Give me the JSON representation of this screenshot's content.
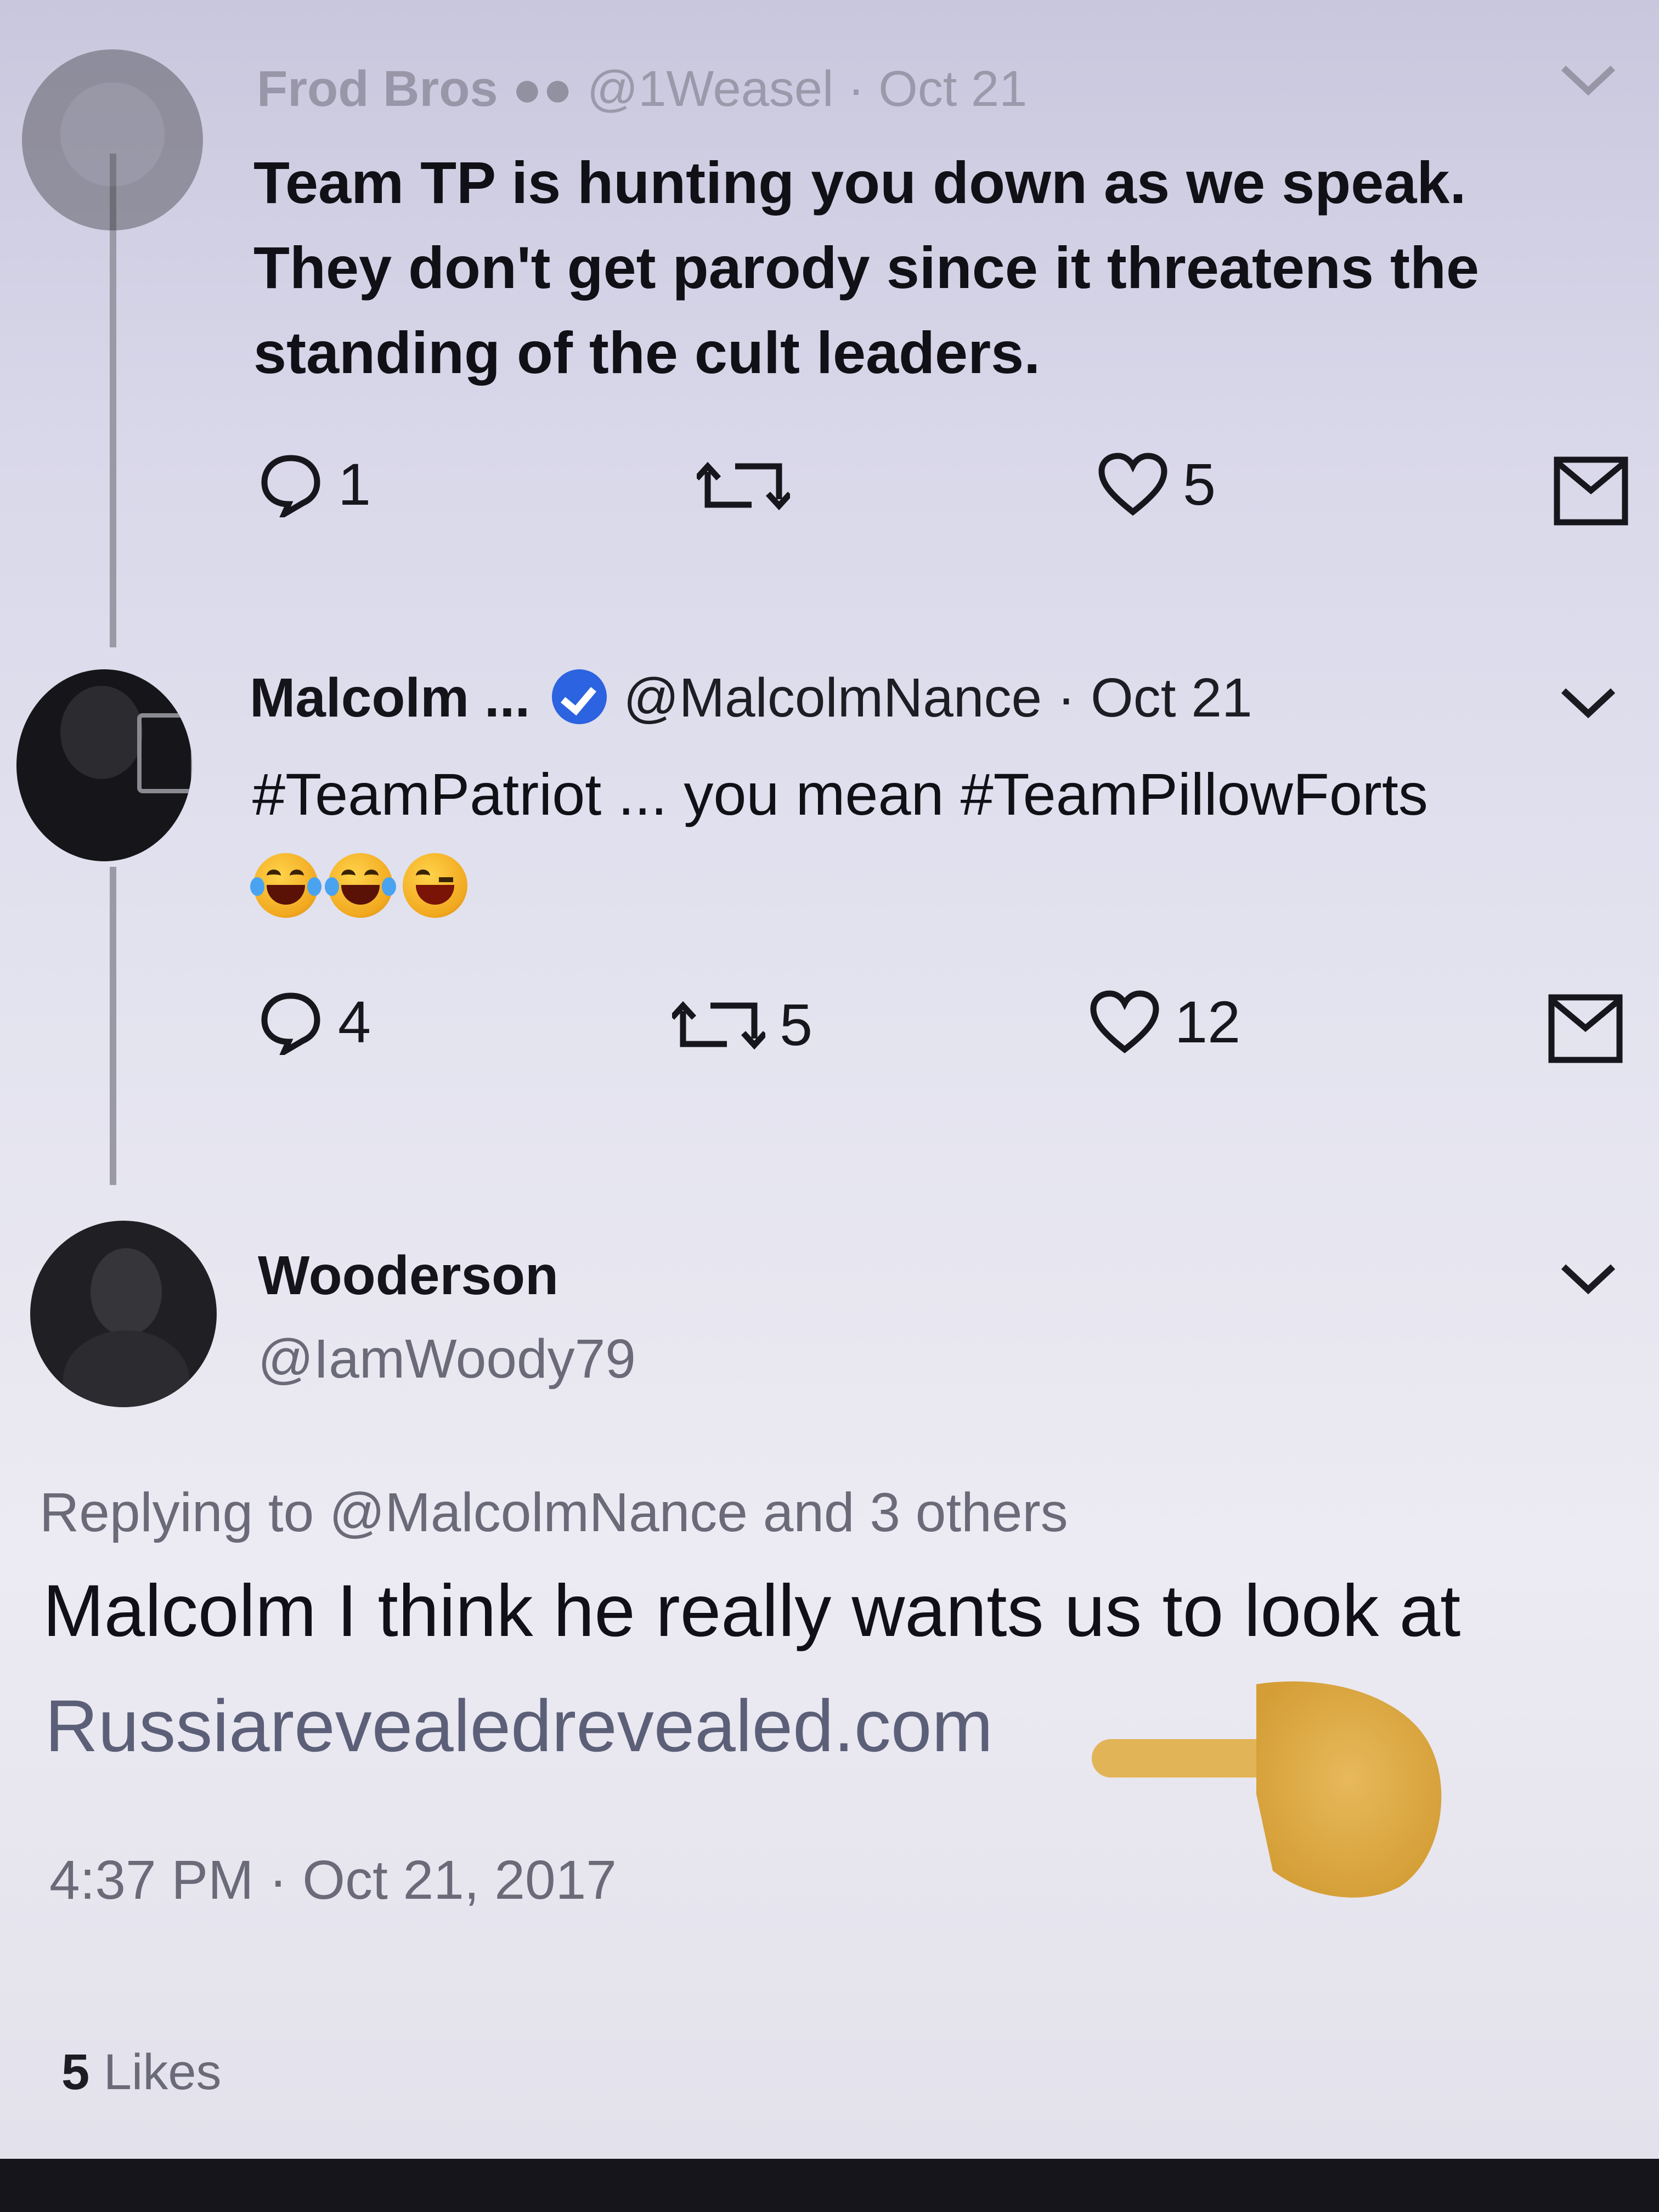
{
  "tweet1": {
    "display_name": "Frod Bros",
    "handle": "@1Weasel",
    "date": "Oct 21",
    "text_line1": "Team TP is hunting you down as we speak.",
    "text_line2": "They don't get parody since it threatens the",
    "text_line3": "standing of the cult leaders.",
    "replies": "1",
    "retweets": "",
    "likes": "5"
  },
  "tweet2": {
    "display_name": "Malcolm ...",
    "handle": "@MalcolmNance",
    "separator": "·",
    "date": "Oct 21",
    "text_line1": "#TeamPatriot ... you mean #TeamPillowForts",
    "emoji": [
      "face-with-tears-of-joy",
      "face-with-tears-of-joy",
      "winking-face-with-tongue"
    ],
    "replies": "4",
    "retweets": "5",
    "likes": "12"
  },
  "tweet3": {
    "display_name": "Wooderson",
    "handle": "@IamWoody79",
    "replying_to": "Replying to @MalcolmNance and 3 others",
    "text_line1": "Malcolm I think he really wants us to look at",
    "text_line2": "Russiarevealedrevealed.com",
    "timestamp": "4:37 PM · Oct 21, 2017",
    "likes_count": "5",
    "likes_label": "Likes"
  },
  "colors": {
    "text": "#101016",
    "gray_text": "#6a6a78",
    "verified_blue": "#2b63e0",
    "link_gray": "#5c5f78"
  }
}
